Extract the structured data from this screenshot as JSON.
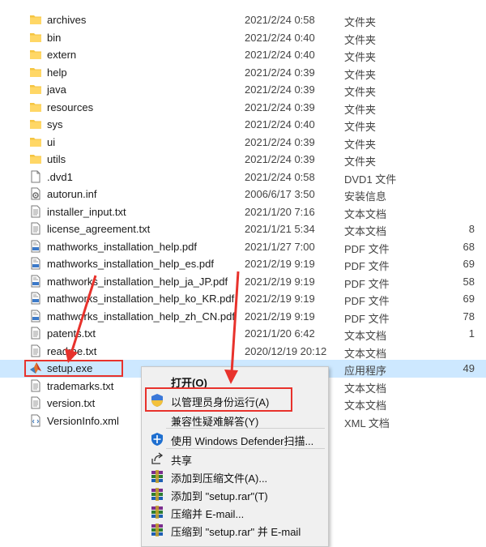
{
  "colors": {
    "folder": "#f5c542",
    "highlight": "#e8322c",
    "selected_row": "#cde8ff",
    "menu_bg": "#f0f0f0"
  },
  "files": [
    {
      "name": "archives",
      "date": "2021/2/24 0:58",
      "type": "文件夹",
      "size": "",
      "icon": "folder-icon"
    },
    {
      "name": "bin",
      "date": "2021/2/24 0:40",
      "type": "文件夹",
      "size": "",
      "icon": "folder-icon"
    },
    {
      "name": "extern",
      "date": "2021/2/24 0:40",
      "type": "文件夹",
      "size": "",
      "icon": "folder-icon"
    },
    {
      "name": "help",
      "date": "2021/2/24 0:39",
      "type": "文件夹",
      "size": "",
      "icon": "folder-icon"
    },
    {
      "name": "java",
      "date": "2021/2/24 0:39",
      "type": "文件夹",
      "size": "",
      "icon": "folder-icon"
    },
    {
      "name": "resources",
      "date": "2021/2/24 0:39",
      "type": "文件夹",
      "size": "",
      "icon": "folder-icon"
    },
    {
      "name": "sys",
      "date": "2021/2/24 0:40",
      "type": "文件夹",
      "size": "",
      "icon": "folder-icon"
    },
    {
      "name": "ui",
      "date": "2021/2/24 0:39",
      "type": "文件夹",
      "size": "",
      "icon": "folder-icon"
    },
    {
      "name": "utils",
      "date": "2021/2/24 0:39",
      "type": "文件夹",
      "size": "",
      "icon": "folder-icon"
    },
    {
      "name": ".dvd1",
      "date": "2021/2/24 0:58",
      "type": "DVD1 文件",
      "size": "",
      "icon": "blank-file-icon"
    },
    {
      "name": "autorun.inf",
      "date": "2006/6/17 3:50",
      "type": "安装信息",
      "size": "",
      "icon": "setup-info-file-icon"
    },
    {
      "name": "installer_input.txt",
      "date": "2021/1/20 7:16",
      "type": "文本文档",
      "size": "",
      "icon": "text-file-icon"
    },
    {
      "name": "license_agreement.txt",
      "date": "2021/1/21 5:34",
      "type": "文本文档",
      "size": "8",
      "icon": "text-file-icon"
    },
    {
      "name": "mathworks_installation_help.pdf",
      "date": "2021/1/27 7:00",
      "type": "PDF 文件",
      "size": "68",
      "icon": "pdf-file-icon"
    },
    {
      "name": "mathworks_installation_help_es.pdf",
      "date": "2021/2/19 9:19",
      "type": "PDF 文件",
      "size": "69",
      "icon": "pdf-file-icon"
    },
    {
      "name": "mathworks_installation_help_ja_JP.pdf",
      "date": "2021/2/19 9:19",
      "type": "PDF 文件",
      "size": "58",
      "icon": "pdf-file-icon"
    },
    {
      "name": "mathworks_installation_help_ko_KR.pdf",
      "date": "2021/2/19 9:19",
      "type": "PDF 文件",
      "size": "69",
      "icon": "pdf-file-icon"
    },
    {
      "name": "mathworks_installation_help_zh_CN.pdf",
      "date": "2021/2/19 9:19",
      "type": "PDF 文件",
      "size": "78",
      "icon": "pdf-file-icon"
    },
    {
      "name": "patents.txt",
      "date": "2021/1/20 6:42",
      "type": "文本文档",
      "size": "1",
      "icon": "text-file-icon"
    },
    {
      "name": "readme.txt",
      "date": "2020/12/19 20:12",
      "type": "文本文档",
      "size": "",
      "icon": "text-file-icon"
    },
    {
      "name": "setup.exe",
      "date": "",
      "type": "应用程序",
      "size": "49",
      "icon": "matlab-app-icon",
      "selected": true
    },
    {
      "name": "trademarks.txt",
      "date": "",
      "type": "文本文档",
      "size": "",
      "icon": "text-file-icon"
    },
    {
      "name": "version.txt",
      "date": "",
      "type": "文本文档",
      "size": "",
      "icon": "text-file-icon"
    },
    {
      "name": "VersionInfo.xml",
      "date": "",
      "type": "XML 文档",
      "size": "",
      "icon": "xml-file-icon"
    }
  ],
  "context_menu": {
    "items": [
      {
        "label": "打开(O)",
        "icon": "",
        "bold": true
      },
      {
        "label": "以管理员身份运行(A)",
        "icon": "uac-shield-icon"
      },
      {
        "label": "兼容性疑难解答(Y)",
        "icon": ""
      },
      {
        "label": "使用 Windows Defender扫描...",
        "icon": "windows-defender-icon"
      },
      {
        "label": "共享",
        "icon": "share-icon"
      },
      {
        "label": "添加到压缩文件(A)...",
        "icon": "winrar-icon"
      },
      {
        "label": "添加到 \"setup.rar\"(T)",
        "icon": "winrar-icon"
      },
      {
        "label": "压缩并 E-mail...",
        "icon": "winrar-icon"
      },
      {
        "label": "压缩到 \"setup.rar\" 并 E-mail",
        "icon": "winrar-icon"
      }
    ]
  }
}
